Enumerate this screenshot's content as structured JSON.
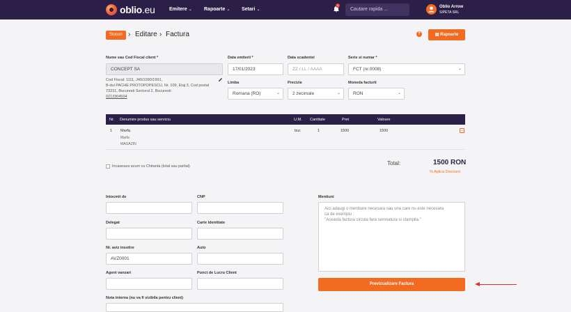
{
  "topbar": {
    "logo_main": "oblio",
    "logo_suffix": ".eu",
    "nav": [
      "Emitere",
      "Rapoarte",
      "Setari"
    ],
    "notification_count": "1",
    "search_placeholder": "Cautare rapida ...",
    "user_name": "Oblio Arrow",
    "user_company": "SIPETA SRL"
  },
  "breadcrumb": {
    "stocuri": "Stocuri",
    "editare": "Editare",
    "factura": "Factura"
  },
  "header_actions": {
    "rapoarte": "Rapoarte"
  },
  "client": {
    "label": "Nume sau Cod Fiscal client *",
    "value": "CONCEPT SA",
    "details_line1": "Cod Fiscal: 1111, J40/1090/1991,",
    "details_line2": "B-dul PACHE PROTOPOPESCU, Nr. 109, Etaj 3, Cod postal",
    "details_line3": "73231, Bucuresti Sectorul 2, Bucuresti",
    "phone": "0213304504"
  },
  "fields": {
    "data_emiterii_label": "Data emiterii *",
    "data_emiterii_value": "17/01/2023",
    "data_scadentei_label": "Data scadentei",
    "data_scadentei_placeholder": "ZZ / LL / AAAA",
    "serie_label": "Serie si numar *",
    "serie_value": "FCT (nr.0008)",
    "limba_label": "Limba",
    "limba_value": "Romana (RO)",
    "precizie_label": "Precizie",
    "precizie_value": "2 zecimale",
    "moneda_label": "Moneda facturii",
    "moneda_value": "RON"
  },
  "table": {
    "headers": [
      "Nr.",
      "Denumire produs sau serviciu",
      "U.M.",
      "Cantitate",
      "Pret",
      "Valoare"
    ],
    "rows": [
      {
        "nr": "1",
        "name": "Marfa",
        "sub1": "Marfa",
        "sub2": "MAGAZIN",
        "um": "buc",
        "qty": "1",
        "price": "1500",
        "value": "1500"
      }
    ]
  },
  "incaseaza_label": "Incaseaza acum cu Chitanta (total sau partial)",
  "totals": {
    "label": "Total:",
    "value": "1500 RON",
    "discount": "% Aplica Discount"
  },
  "bottom": {
    "intocmit_label": "Intocmit de",
    "cnp_label": "CNP",
    "delegat_label": "Delegat",
    "carte_label": "Carte Identitate",
    "aviz_label": "Nr. aviz insotire",
    "aviz_value": "AVZ0001",
    "auto_label": "Auto",
    "agent_label": "Agent vanzari",
    "punct_label": "Punct de Lucru Client",
    "nota_label": "Nota interna (nu va fi vizibila pentru client)",
    "mentiuni_label": "Mentiuni",
    "mentiuni_line1": "Aici adaugi o mentiune necesara sau una care nu este necesara",
    "mentiuni_line2": "ca de exemplu :",
    "mentiuni_line3": "\"Aceasta factura circula fara semnatura si stampila.\"",
    "preview_button": "Previzualizare Factura"
  },
  "colors": {
    "topbar": "#2c1f47",
    "accent": "#f26b21",
    "total": "#2c1f47"
  }
}
